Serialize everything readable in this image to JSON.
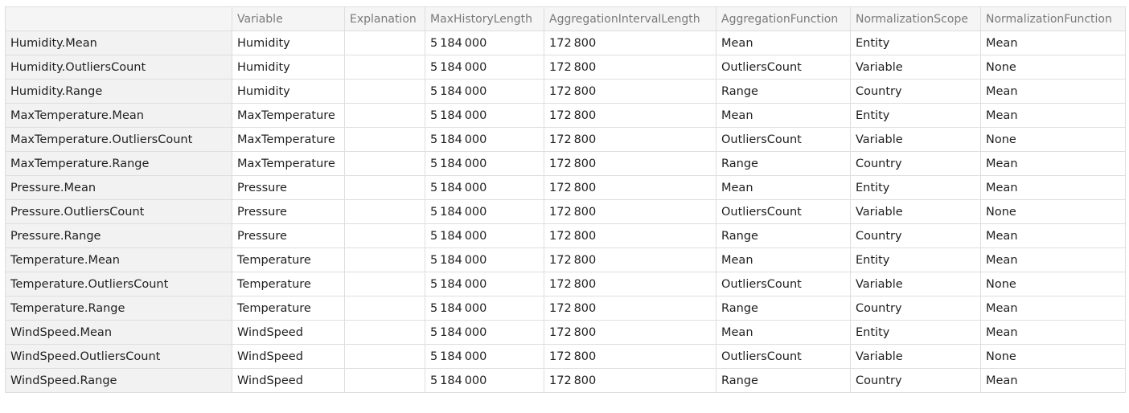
{
  "table": {
    "columns": [
      "",
      "Variable",
      "Explanation",
      "MaxHistoryLength",
      "AggregationIntervalLength",
      "AggregationFunction",
      "NormalizationScope",
      "NormalizationFunction"
    ],
    "rows": [
      {
        "key": "Humidity.Mean",
        "cells": [
          "Humidity",
          "",
          "5184000",
          "172800",
          "Mean",
          "Entity",
          "Mean"
        ]
      },
      {
        "key": "Humidity.OutliersCount",
        "cells": [
          "Humidity",
          "",
          "5184000",
          "172800",
          "OutliersCount",
          "Variable",
          "None"
        ]
      },
      {
        "key": "Humidity.Range",
        "cells": [
          "Humidity",
          "",
          "5184000",
          "172800",
          "Range",
          "Country",
          "Mean"
        ]
      },
      {
        "key": "MaxTemperature.Mean",
        "cells": [
          "MaxTemperature",
          "",
          "5184000",
          "172800",
          "Mean",
          "Entity",
          "Mean"
        ]
      },
      {
        "key": "MaxTemperature.OutliersCount",
        "cells": [
          "MaxTemperature",
          "",
          "5184000",
          "172800",
          "OutliersCount",
          "Variable",
          "None"
        ]
      },
      {
        "key": "MaxTemperature.Range",
        "cells": [
          "MaxTemperature",
          "",
          "5184000",
          "172800",
          "Range",
          "Country",
          "Mean"
        ]
      },
      {
        "key": "Pressure.Mean",
        "cells": [
          "Pressure",
          "",
          "5184000",
          "172800",
          "Mean",
          "Entity",
          "Mean"
        ]
      },
      {
        "key": "Pressure.OutliersCount",
        "cells": [
          "Pressure",
          "",
          "5184000",
          "172800",
          "OutliersCount",
          "Variable",
          "None"
        ]
      },
      {
        "key": "Pressure.Range",
        "cells": [
          "Pressure",
          "",
          "5184000",
          "172800",
          "Range",
          "Country",
          "Mean"
        ]
      },
      {
        "key": "Temperature.Mean",
        "cells": [
          "Temperature",
          "",
          "5184000",
          "172800",
          "Mean",
          "Entity",
          "Mean"
        ]
      },
      {
        "key": "Temperature.OutliersCount",
        "cells": [
          "Temperature",
          "",
          "5184000",
          "172800",
          "OutliersCount",
          "Variable",
          "None"
        ]
      },
      {
        "key": "Temperature.Range",
        "cells": [
          "Temperature",
          "",
          "5184000",
          "172800",
          "Range",
          "Country",
          "Mean"
        ]
      },
      {
        "key": "WindSpeed.Mean",
        "cells": [
          "WindSpeed",
          "",
          "5184000",
          "172800",
          "Mean",
          "Entity",
          "Mean"
        ]
      },
      {
        "key": "WindSpeed.OutliersCount",
        "cells": [
          "WindSpeed",
          "",
          "5184000",
          "172800",
          "OutliersCount",
          "Variable",
          "None"
        ]
      },
      {
        "key": "WindSpeed.Range",
        "cells": [
          "WindSpeed",
          "",
          "5184000",
          "172800",
          "Range",
          "Country",
          "Mean"
        ]
      }
    ]
  }
}
